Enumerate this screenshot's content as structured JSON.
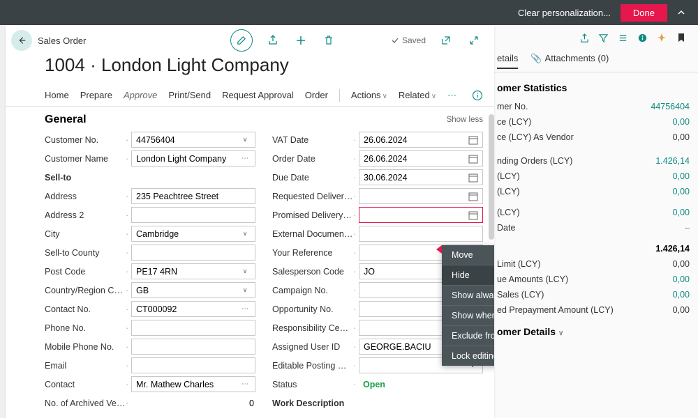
{
  "topbar": {
    "clear_text": "Clear personalization...",
    "done_label": "Done"
  },
  "header": {
    "breadcrumb": "Sales Order",
    "saved_label": "Saved",
    "title": "1004 · London Light Company"
  },
  "menu": {
    "items": [
      "Home",
      "Prepare",
      "Approve",
      "Print/Send",
      "Request Approval",
      "Order"
    ],
    "actions": "Actions",
    "related": "Related"
  },
  "section": {
    "general": "General",
    "showless": "Show less"
  },
  "fields_left": {
    "customer_no": {
      "label": "Customer No.",
      "value": "44756404"
    },
    "customer_name": {
      "label": "Customer Name",
      "value": "London Light Company"
    },
    "sellto": "Sell-to",
    "address": {
      "label": "Address",
      "value": "235 Peachtree Street"
    },
    "address2": {
      "label": "Address 2",
      "value": ""
    },
    "city": {
      "label": "City",
      "value": "Cambridge"
    },
    "county": {
      "label": "Sell-to County",
      "value": ""
    },
    "postcode": {
      "label": "Post Code",
      "value": "PE17 4RN"
    },
    "country": {
      "label": "Country/Region Code",
      "value": "GB"
    },
    "contact_no": {
      "label": "Contact No.",
      "value": "CT000092"
    },
    "phone": {
      "label": "Phone No.",
      "value": ""
    },
    "mobile": {
      "label": "Mobile Phone No.",
      "value": ""
    },
    "email": {
      "label": "Email",
      "value": ""
    },
    "contact": {
      "label": "Contact",
      "value": "Mr. Mathew Charles"
    },
    "archived": {
      "label": "No. of Archived Versi...",
      "value": "0"
    }
  },
  "fields_right": {
    "vat_date": {
      "label": "VAT Date",
      "value": "26.06.2024"
    },
    "order_date": {
      "label": "Order Date",
      "value": "26.06.2024"
    },
    "due_date": {
      "label": "Due Date",
      "value": "30.06.2024"
    },
    "req_deliv": {
      "label": "Requested Delivery D...",
      "value": ""
    },
    "prom_deliv": {
      "label": "Promised Delivery Da...",
      "value": ""
    },
    "ext_doc": {
      "label": "External Document No.",
      "value": ""
    },
    "your_ref": {
      "label": "Your Reference",
      "value": ""
    },
    "salesperson": {
      "label": "Salesperson Code",
      "value": "JO"
    },
    "campaign": {
      "label": "Campaign No.",
      "value": ""
    },
    "opportunity": {
      "label": "Opportunity No.",
      "value": ""
    },
    "resp_center": {
      "label": "Responsibility Center",
      "value": ""
    },
    "assigned_user": {
      "label": "Assigned User ID",
      "value": "GEORGE.BACIU"
    },
    "posting_group": {
      "label": "Editable Posting Group",
      "value": ""
    },
    "status": {
      "label": "Status",
      "value": "Open"
    },
    "work_desc": "Work Description"
  },
  "context_menu": {
    "move": "Move",
    "hide": "Hide",
    "show_always": "Show always",
    "show_collapsed": "Show when collapsed",
    "exclude": "Exclude from Quick Entry",
    "lock": "Lock editing"
  },
  "side": {
    "tabs": {
      "details": "etails",
      "attachments": "Attachments (0)"
    },
    "stats_title": "omer Statistics",
    "rows": {
      "cust_no": {
        "label": "mer No.",
        "value": "44756404"
      },
      "balance": {
        "label": "ce (LCY)",
        "value": "0,00"
      },
      "vendor": {
        "label": "ce (LCY) As Vendor",
        "value": "0,00"
      },
      "orders": {
        "label": "nding Orders (LCY)",
        "value": "1.426,14"
      },
      "shipped": {
        "label": " (LCY)",
        "value": "0,00"
      },
      "other": {
        "label": " (LCY)",
        "value": "0,00"
      },
      "date": {
        "label": "Date",
        "value": "–"
      },
      "total": {
        "label": "",
        "value": "1.426,14"
      },
      "limit": {
        "label": "Limit (LCY)",
        "value": "0,00"
      },
      "overdue": {
        "label": "ue Amounts (LCY)",
        "value": "0,00"
      },
      "sales": {
        "label": "Sales (LCY)",
        "value": "0,00"
      },
      "prepay": {
        "label": "ed Prepayment Amount (LCY)",
        "value": "0,00"
      }
    },
    "details_hdr": "omer Details"
  }
}
